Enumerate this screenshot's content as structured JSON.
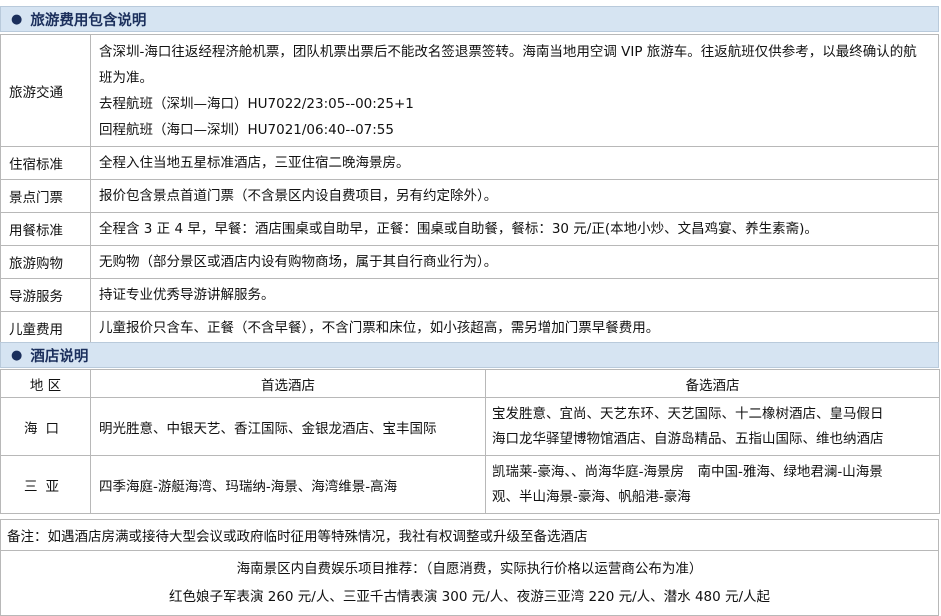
{
  "fees_section": {
    "title": "旅游费用包含说明",
    "rows": [
      {
        "label": "旅游交通",
        "lines": [
          "含深圳-海口往返经程济舱机票，团队机票出票后不能改名签退票签转。海南当地用空调 VIP 旅游车。往返航班仅供参考，以最终确认的航班为准。",
          "去程航班（深圳—海口）HU7022/23:05--00:25+1",
          "回程航班（海口—深圳）HU7021/06:40--07:55"
        ]
      },
      {
        "label": "住宿标准",
        "lines": [
          "全程入住当地五星标准酒店，三亚住宿二晚海景房。"
        ]
      },
      {
        "label": "景点门票",
        "lines": [
          "报价包含景点首道门票（不含景区内设自费项目，另有约定除外）。"
        ]
      },
      {
        "label": "用餐标准",
        "lines": [
          "全程含 3 正 4 早，早餐：酒店围桌或自助早，正餐：围桌或自助餐，餐标：30 元/正(本地小炒、文昌鸡宴、养生素斋)。"
        ]
      },
      {
        "label": "旅游购物",
        "lines": [
          "无购物（部分景区或酒店内设有购物商场，属于其自行商业行为）。"
        ]
      },
      {
        "label": "导游服务",
        "lines": [
          "持证专业优秀导游讲解服务。"
        ]
      },
      {
        "label": "儿童费用",
        "lines": [
          "儿童报价只含车、正餐（不含早餐），不含门票和床位，如小孩超高，需另增加门票早餐费用。"
        ]
      }
    ]
  },
  "hotel_section": {
    "title": "酒店说明",
    "headers": {
      "area": "地 区",
      "preferred": "首选酒店",
      "alternate": "备选酒店"
    },
    "rows": [
      {
        "area": "海口",
        "preferred": "明光胜意、中银天艺、香江国际、金银龙酒店、宝丰国际",
        "alternate": [
          "宝发胜意、宜尚、天艺东环、天艺国际、十二橡树酒店、皇马假日",
          "海口龙华驿望博物馆酒店、自游岛精品、五指山国际、维也纳酒店"
        ]
      },
      {
        "area": "三亚",
        "preferred": "四季海庭-游艇海湾、玛瑞纳-海景、海湾维景-高海",
        "alternate": [
          "凯瑞莱-豪海、、尚海华庭-海景房　南中国-雅海、绿地君澜-山海景",
          "观、半山海景-豪海、帆船港-豪海"
        ]
      }
    ]
  },
  "notes": {
    "remark": "备注：如遇酒店房满或接待大型会议或政府临时征用等特殊情况，我社有权调整或升级至备选酒店",
    "recommend_title": "海南景区内自费娱乐项目推荐：（自愿消费，实际执行价格以运营商公布为准）",
    "recommend_items": "红色娘子军表演 260 元/人、三亚千古情表演 300 元/人、夜游三亚湾 220 元/人、潜水 480 元/人起"
  }
}
